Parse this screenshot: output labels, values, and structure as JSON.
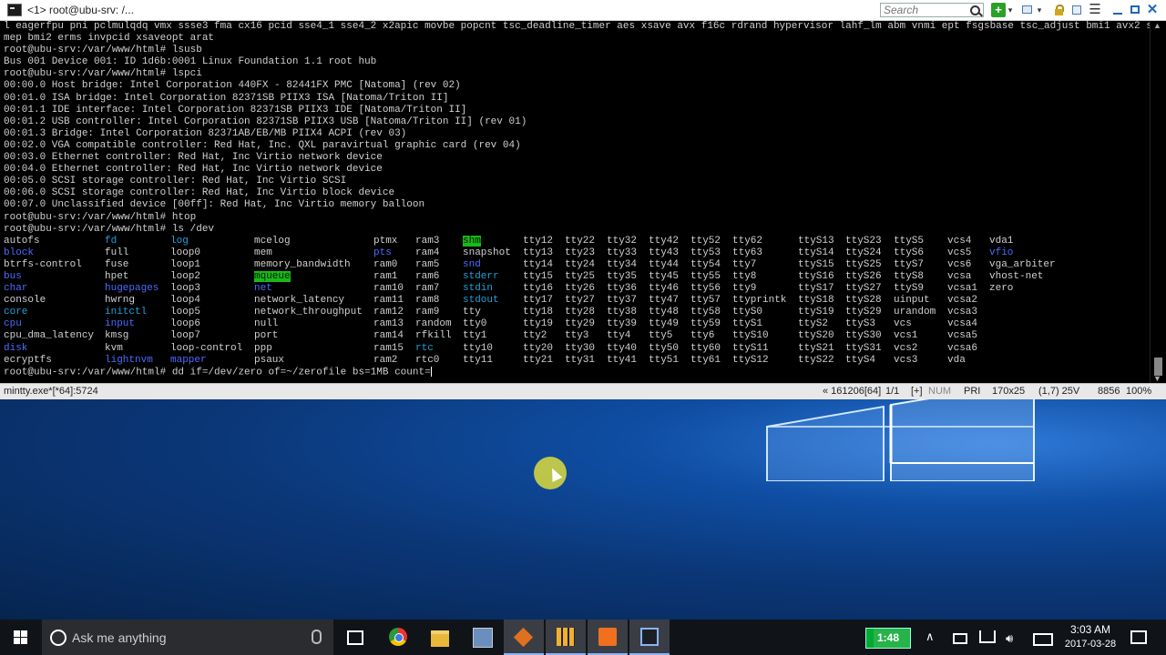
{
  "window": {
    "tab_title": "<1> root@ubu-srv: /...",
    "search_placeholder": "Search"
  },
  "terminal": {
    "lines": [
      "l eagerfpu pni pclmulqdq vmx ssse3 fma cx16 pcid sse4_1 sse4_2 x2apic movbe popcnt tsc_deadline_timer aes xsave avx f16c rdrand hypervisor lahf_lm abm vnmi ept fsgsbase tsc_adjust bmi1 avx2 s",
      "mep bmi2 erms invpcid xsaveopt arat",
      "root@ubu-srv:/var/www/html# lsusb",
      "Bus 001 Device 001: ID 1d6b:0001 Linux Foundation 1.1 root hub",
      "root@ubu-srv:/var/www/html# lspci",
      "00:00.0 Host bridge: Intel Corporation 440FX - 82441FX PMC [Natoma] (rev 02)",
      "00:01.0 ISA bridge: Intel Corporation 82371SB PIIX3 ISA [Natoma/Triton II]",
      "00:01.1 IDE interface: Intel Corporation 82371SB PIIX3 IDE [Natoma/Triton II]",
      "00:01.2 USB controller: Intel Corporation 82371SB PIIX3 USB [Natoma/Triton II] (rev 01)",
      "00:01.3 Bridge: Intel Corporation 82371AB/EB/MB PIIX4 ACPI (rev 03)",
      "00:02.0 VGA compatible controller: Red Hat, Inc. QXL paravirtual graphic card (rev 04)",
      "00:03.0 Ethernet controller: Red Hat, Inc Virtio network device",
      "00:04.0 Ethernet controller: Red Hat, Inc Virtio network device",
      "00:05.0 SCSI storage controller: Red Hat, Inc Virtio SCSI",
      "00:06.0 SCSI storage controller: Red Hat, Inc Virtio block device",
      "00:07.0 Unclassified device [00ff]: Red Hat, Inc Virtio memory balloon",
      "root@ubu-srv:/var/www/html# htop",
      "root@ubu-srv:/var/www/html# ls /dev"
    ],
    "ls_columns": [
      [
        [
          "autofs",
          "w"
        ],
        [
          "block",
          "b"
        ],
        [
          "btrfs-control",
          "w"
        ],
        [
          "bus",
          "b"
        ],
        [
          "char",
          "b"
        ],
        [
          "console",
          "w"
        ],
        [
          "core",
          "c"
        ],
        [
          "cpu",
          "b"
        ],
        [
          "cpu_dma_latency",
          "w"
        ],
        [
          "disk",
          "b"
        ],
        [
          "ecryptfs",
          "w"
        ]
      ],
      [
        [
          "fd",
          "c"
        ],
        [
          "full",
          "w"
        ],
        [
          "fuse",
          "w"
        ],
        [
          "hpet",
          "w"
        ],
        [
          "hugepages",
          "b"
        ],
        [
          "hwrng",
          "w"
        ],
        [
          "initctl",
          "c"
        ],
        [
          "input",
          "b"
        ],
        [
          "kmsg",
          "w"
        ],
        [
          "kvm",
          "w"
        ],
        [
          "lightnvm",
          "b"
        ]
      ],
      [
        [
          "log",
          "c"
        ],
        [
          "loop0",
          "w"
        ],
        [
          "loop1",
          "w"
        ],
        [
          "loop2",
          "w"
        ],
        [
          "loop3",
          "w"
        ],
        [
          "loop4",
          "w"
        ],
        [
          "loop5",
          "w"
        ],
        [
          "loop6",
          "w"
        ],
        [
          "loop7",
          "w"
        ],
        [
          "loop-control",
          "w"
        ],
        [
          "mapper",
          "b"
        ]
      ],
      [
        [
          "mcelog",
          "w"
        ],
        [
          "mem",
          "w"
        ],
        [
          "memory_bandwidth",
          "w"
        ],
        [
          "mqueue",
          "hl"
        ],
        [
          "net",
          "b"
        ],
        [
          "network_latency",
          "w"
        ],
        [
          "network_throughput",
          "w"
        ],
        [
          "null",
          "w"
        ],
        [
          "port",
          "w"
        ],
        [
          "ppp",
          "w"
        ],
        [
          "psaux",
          "w"
        ]
      ],
      [
        [
          "ptmx",
          "w"
        ],
        [
          "pts",
          "b"
        ],
        [
          "ram0",
          "w"
        ],
        [
          "ram1",
          "w"
        ],
        [
          "ram10",
          "w"
        ],
        [
          "ram11",
          "w"
        ],
        [
          "ram12",
          "w"
        ],
        [
          "ram13",
          "w"
        ],
        [
          "ram14",
          "w"
        ],
        [
          "ram15",
          "w"
        ],
        [
          "ram2",
          "w"
        ]
      ],
      [
        [
          "ram3",
          "w"
        ],
        [
          "ram4",
          "w"
        ],
        [
          "ram5",
          "w"
        ],
        [
          "ram6",
          "w"
        ],
        [
          "ram7",
          "w"
        ],
        [
          "ram8",
          "w"
        ],
        [
          "ram9",
          "w"
        ],
        [
          "random",
          "w"
        ],
        [
          "rfkill",
          "w"
        ],
        [
          "rtc",
          "c"
        ],
        [
          "rtc0",
          "w"
        ]
      ],
      [
        [
          "shm",
          "hl"
        ],
        [
          "snapshot",
          "w"
        ],
        [
          "snd",
          "b"
        ],
        [
          "stderr",
          "c"
        ],
        [
          "stdin",
          "c"
        ],
        [
          "stdout",
          "c"
        ],
        [
          "tty",
          "w"
        ],
        [
          "tty0",
          "w"
        ],
        [
          "tty1",
          "w"
        ],
        [
          "tty10",
          "w"
        ],
        [
          "tty11",
          "w"
        ]
      ],
      [
        [
          "tty12",
          "w"
        ],
        [
          "tty13",
          "w"
        ],
        [
          "tty14",
          "w"
        ],
        [
          "tty15",
          "w"
        ],
        [
          "tty16",
          "w"
        ],
        [
          "tty17",
          "w"
        ],
        [
          "tty18",
          "w"
        ],
        [
          "tty19",
          "w"
        ],
        [
          "tty2",
          "w"
        ],
        [
          "tty20",
          "w"
        ],
        [
          "tty21",
          "w"
        ]
      ],
      [
        [
          "tty22",
          "w"
        ],
        [
          "tty23",
          "w"
        ],
        [
          "tty24",
          "w"
        ],
        [
          "tty25",
          "w"
        ],
        [
          "tty26",
          "w"
        ],
        [
          "tty27",
          "w"
        ],
        [
          "tty28",
          "w"
        ],
        [
          "tty29",
          "w"
        ],
        [
          "tty3",
          "w"
        ],
        [
          "tty30",
          "w"
        ],
        [
          "tty31",
          "w"
        ]
      ],
      [
        [
          "tty32",
          "w"
        ],
        [
          "tty33",
          "w"
        ],
        [
          "tty34",
          "w"
        ],
        [
          "tty35",
          "w"
        ],
        [
          "tty36",
          "w"
        ],
        [
          "tty37",
          "w"
        ],
        [
          "tty38",
          "w"
        ],
        [
          "tty39",
          "w"
        ],
        [
          "tty4",
          "w"
        ],
        [
          "tty40",
          "w"
        ],
        [
          "tty41",
          "w"
        ]
      ],
      [
        [
          "tty42",
          "w"
        ],
        [
          "tty43",
          "w"
        ],
        [
          "tty44",
          "w"
        ],
        [
          "tty45",
          "w"
        ],
        [
          "tty46",
          "w"
        ],
        [
          "tty47",
          "w"
        ],
        [
          "tty48",
          "w"
        ],
        [
          "tty49",
          "w"
        ],
        [
          "tty5",
          "w"
        ],
        [
          "tty50",
          "w"
        ],
        [
          "tty51",
          "w"
        ]
      ],
      [
        [
          "tty52",
          "w"
        ],
        [
          "tty53",
          "w"
        ],
        [
          "tty54",
          "w"
        ],
        [
          "tty55",
          "w"
        ],
        [
          "tty56",
          "w"
        ],
        [
          "tty57",
          "w"
        ],
        [
          "tty58",
          "w"
        ],
        [
          "tty59",
          "w"
        ],
        [
          "tty6",
          "w"
        ],
        [
          "tty60",
          "w"
        ],
        [
          "tty61",
          "w"
        ]
      ],
      [
        [
          "tty62",
          "w"
        ],
        [
          "tty63",
          "w"
        ],
        [
          "tty7",
          "w"
        ],
        [
          "tty8",
          "w"
        ],
        [
          "tty9",
          "w"
        ],
        [
          "ttyprintk",
          "w"
        ],
        [
          "ttyS0",
          "w"
        ],
        [
          "ttyS1",
          "w"
        ],
        [
          "ttyS10",
          "w"
        ],
        [
          "ttyS11",
          "w"
        ],
        [
          "ttyS12",
          "w"
        ]
      ],
      [
        [
          "ttyS13",
          "w"
        ],
        [
          "ttyS14",
          "w"
        ],
        [
          "ttyS15",
          "w"
        ],
        [
          "ttyS16",
          "w"
        ],
        [
          "ttyS17",
          "w"
        ],
        [
          "ttyS18",
          "w"
        ],
        [
          "ttyS19",
          "w"
        ],
        [
          "ttyS2",
          "w"
        ],
        [
          "ttyS20",
          "w"
        ],
        [
          "ttyS21",
          "w"
        ],
        [
          "ttyS22",
          "w"
        ]
      ],
      [
        [
          "ttyS23",
          "w"
        ],
        [
          "ttyS24",
          "w"
        ],
        [
          "ttyS25",
          "w"
        ],
        [
          "ttyS26",
          "w"
        ],
        [
          "ttyS27",
          "w"
        ],
        [
          "ttyS28",
          "w"
        ],
        [
          "ttyS29",
          "w"
        ],
        [
          "ttyS3",
          "w"
        ],
        [
          "ttyS30",
          "w"
        ],
        [
          "ttyS31",
          "w"
        ],
        [
          "ttyS4",
          "w"
        ]
      ],
      [
        [
          "ttyS5",
          "w"
        ],
        [
          "ttyS6",
          "w"
        ],
        [
          "ttyS7",
          "w"
        ],
        [
          "ttyS8",
          "w"
        ],
        [
          "ttyS9",
          "w"
        ],
        [
          "uinput",
          "w"
        ],
        [
          "urandom",
          "w"
        ],
        [
          "vcs",
          "w"
        ],
        [
          "vcs1",
          "w"
        ],
        [
          "vcs2",
          "w"
        ],
        [
          "vcs3",
          "w"
        ]
      ],
      [
        [
          "vcs4",
          "w"
        ],
        [
          "vcs5",
          "w"
        ],
        [
          "vcs6",
          "w"
        ],
        [
          "vcsa",
          "w"
        ],
        [
          "vcsa1",
          "w"
        ],
        [
          "vcsa2",
          "w"
        ],
        [
          "vcsa3",
          "w"
        ],
        [
          "vcsa4",
          "w"
        ],
        [
          "vcsa5",
          "w"
        ],
        [
          "vcsa6",
          "w"
        ],
        [
          "vda",
          "w"
        ]
      ],
      [
        [
          "vda1",
          "w"
        ],
        [
          "vfio",
          "b"
        ],
        [
          "vga_arbiter",
          "w"
        ],
        [
          "vhost-net",
          "w"
        ],
        [
          "zero",
          "w"
        ]
      ]
    ],
    "prompt_line": "root@ubu-srv:/var/www/html# dd if=/dev/zero of=~/zerofile bs=1MB count="
  },
  "statusbar": {
    "left": "mintty.exe*[*64]:5724",
    "position": "« 161206[64]",
    "page": "1/1",
    "plus": "[+]",
    "num": "NUM",
    "pri": "PRI",
    "size": "170x25",
    "cursor": "(1,7) 25V",
    "codepage": "8856",
    "zoom": "100%"
  },
  "taskbar": {
    "search_placeholder": "Ask me anything",
    "tray_clock_label": "1:48",
    "time": "3:03 AM",
    "date": "2017-03-28"
  },
  "colors": {
    "terminal_bg": "#000000",
    "blue_dir": "#4a6cff",
    "cyan_link": "#1fa0d8",
    "highlight_bg": "#18b818",
    "taskbar_bg": "#101418"
  }
}
